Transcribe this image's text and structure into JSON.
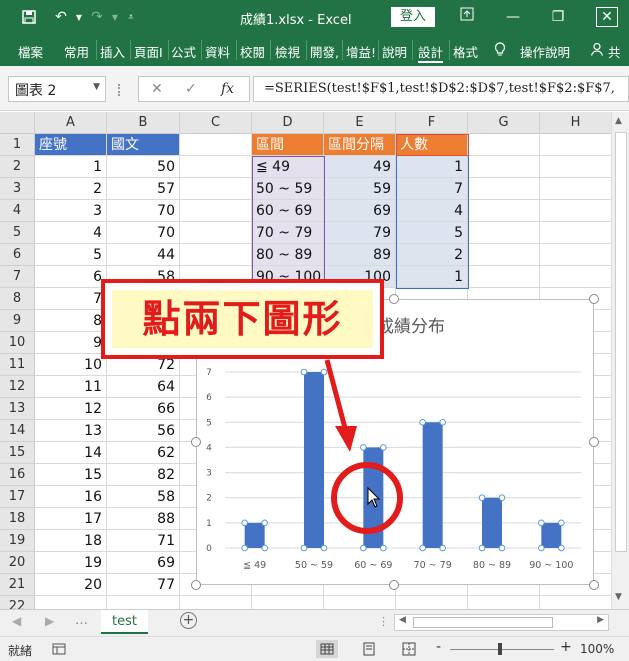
{
  "titlebar": {
    "title": "成績1.xlsx - Excel",
    "login": "登入",
    "save_icon": "save-icon",
    "undo_icon": "undo-icon",
    "redo_icon": "redo-icon",
    "customize_icon": "customize-icon"
  },
  "ribbon": {
    "tabs": [
      "檔案",
      "常用",
      "插入",
      "頁面I",
      "公式",
      "資料",
      "校閱",
      "檢視",
      "開發,",
      "增益!",
      "說明",
      "設計",
      "格式"
    ],
    "tell_me": "操作說明",
    "share": "共"
  },
  "formula_bar": {
    "name_box": "圖表 2",
    "cancel": "✕",
    "enter": "✓",
    "fx": "fx",
    "formula": "=SERIES(test!$F$1,test!$D$2:$D$7,test!$F$2:$F$7,"
  },
  "columns": [
    "A",
    "B",
    "C",
    "D",
    "E",
    "F",
    "G",
    "H"
  ],
  "rows": [
    "1",
    "2",
    "3",
    "4",
    "5",
    "6",
    "7",
    "8",
    "9",
    "10",
    "11",
    "12",
    "13",
    "14",
    "15",
    "16",
    "17",
    "18",
    "19",
    "20",
    "21",
    "22"
  ],
  "table": {
    "header": [
      "座號",
      "國文"
    ],
    "data": [
      [
        "1",
        "50"
      ],
      [
        "2",
        "57"
      ],
      [
        "3",
        "70"
      ],
      [
        "4",
        "70"
      ],
      [
        "5",
        "44"
      ],
      [
        "6",
        "58"
      ],
      [
        "7",
        ""
      ],
      [
        "8",
        ""
      ],
      [
        "9",
        ""
      ],
      [
        "10",
        "72"
      ],
      [
        "11",
        "64"
      ],
      [
        "12",
        "66"
      ],
      [
        "13",
        "56"
      ],
      [
        "14",
        "62"
      ],
      [
        "15",
        "82"
      ],
      [
        "16",
        "58"
      ],
      [
        "17",
        "88"
      ],
      [
        "18",
        "71"
      ],
      [
        "19",
        "69"
      ],
      [
        "20",
        "77"
      ]
    ]
  },
  "freq_table": {
    "header": [
      "區間",
      "區間分隔",
      "人數"
    ],
    "rows": [
      [
        "≦ 49",
        "49",
        "1"
      ],
      [
        "50 ~ 59",
        "59",
        "7"
      ],
      [
        "60 ~ 69",
        "69",
        "4"
      ],
      [
        "70 ~ 79",
        "79",
        "5"
      ],
      [
        "80 ~ 89",
        "89",
        "2"
      ],
      [
        "90 ~ 100",
        "100",
        "1"
      ]
    ]
  },
  "chart_data": {
    "type": "bar",
    "title": "成績分布",
    "categories": [
      "≦ 49",
      "50 ~ 59",
      "60 ~ 69",
      "70 ~ 79",
      "80 ~ 89",
      "90 ~ 100"
    ],
    "values": [
      1,
      7,
      4,
      5,
      2,
      1
    ],
    "ylim": [
      0,
      7
    ],
    "yticks": [
      0,
      1,
      2,
      3,
      4,
      5,
      6,
      7
    ],
    "grid": true,
    "bar_color": "#4472c4"
  },
  "annotation": {
    "callout_text": "點兩下圖形",
    "color": "#e21b1b"
  },
  "sheetbar": {
    "tab": "test",
    "add_icon": "plus-circle-icon"
  },
  "statusbar": {
    "ready": "就緒",
    "zoom": "100%",
    "zoom_minus": "-",
    "zoom_plus": "+"
  }
}
